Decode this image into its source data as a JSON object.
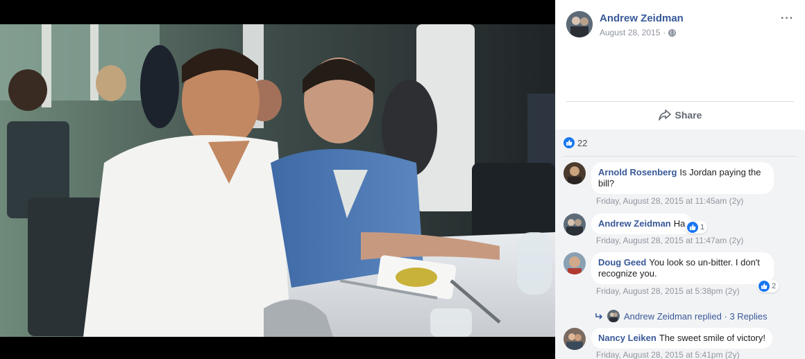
{
  "post": {
    "author": "Andrew Zeidman",
    "date": "August 28, 2015",
    "separator": "·",
    "privacy_icon": "globe-icon",
    "more_label": "···",
    "share_label": "Share",
    "like_count": "22"
  },
  "comments": [
    {
      "name": "Arnold Rosenberg",
      "text": "Is Jordan paying the bill?",
      "time": "Friday, August 28, 2015 at 11:45am (2y)"
    },
    {
      "name": "Andrew Zeidman",
      "text": "Ha",
      "time": "Friday, August 28, 2015 at 11:47am (2y)",
      "reactions": "1"
    },
    {
      "name": "Doug Geed",
      "text": "You look so un-bitter. I don't recognize you.",
      "time": "Friday, August 28, 2015 at 5:38pm (2y)",
      "reactions": "2",
      "replies_text": "Andrew Zeidman replied · 3 Replies"
    },
    {
      "name": "Nancy Leiken",
      "text": "The sweet smile of victory!",
      "time": "Friday, August 28, 2015 at 5:41pm (2y)"
    }
  ],
  "colors": {
    "link": "#385898",
    "like_blue": "#1877f2",
    "panel_bg": "#f2f3f5"
  }
}
